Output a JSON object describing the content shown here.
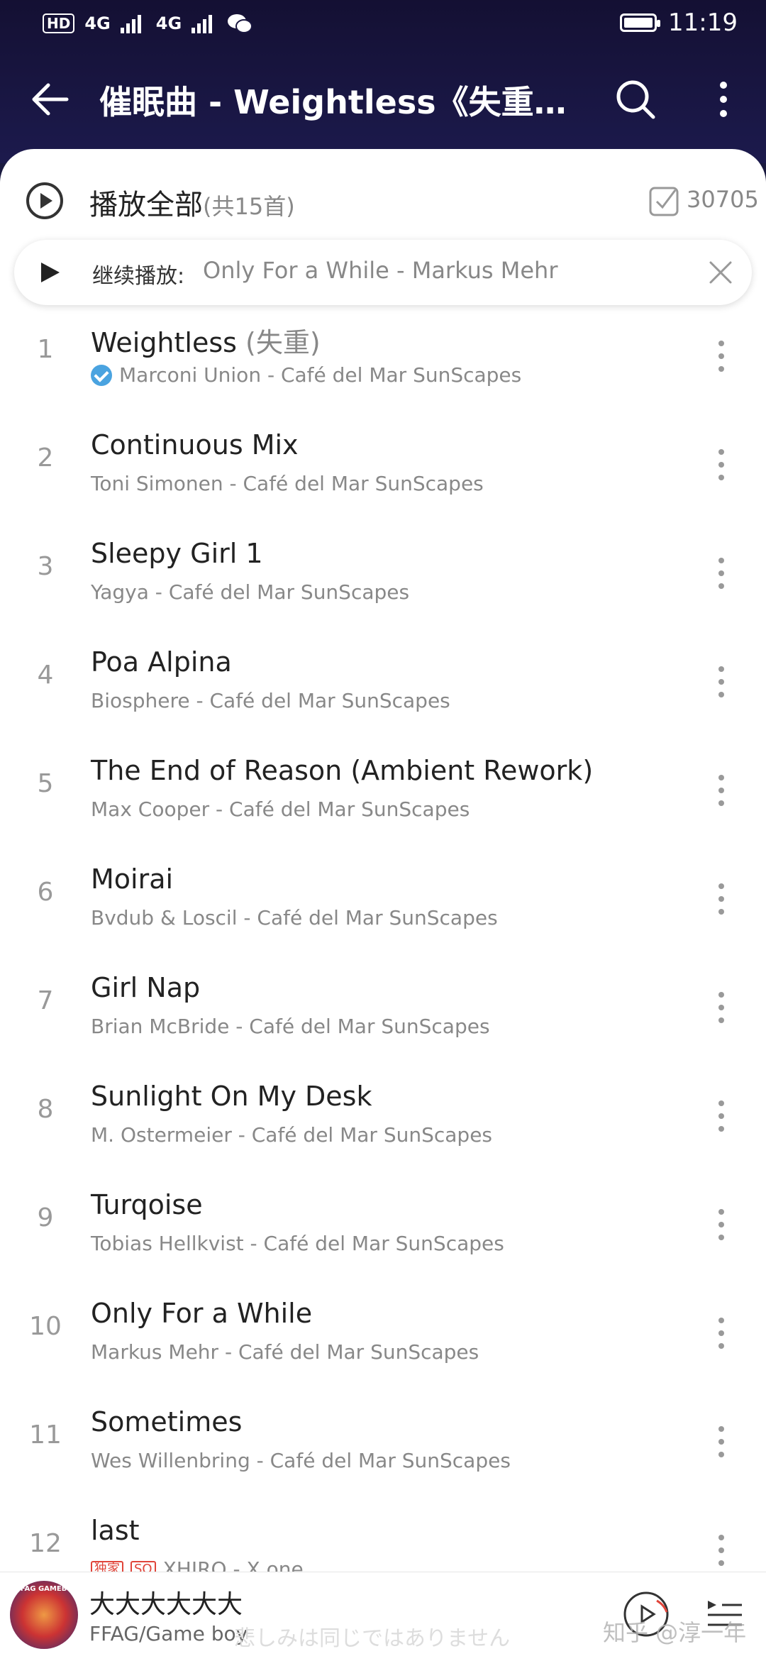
{
  "status_bar": {
    "hd": "HD",
    "net1": "4G",
    "net2": "4G",
    "time": "11:19"
  },
  "header": {
    "title": "催眠曲 - Weightless《失重》等..."
  },
  "play_all": {
    "label": "播放全部",
    "count": "(共15首)",
    "select_count": "30705"
  },
  "resume": {
    "label": "继续播放:",
    "track": "Only For a While - Markus Mehr"
  },
  "songs": [
    {
      "num": "1",
      "title": "Weightless",
      "alt": " (失重)",
      "subtitle": "Marconi Union - Café del Mar SunScapes"
    },
    {
      "num": "2",
      "title": "Continuous Mix",
      "alt": "",
      "subtitle": "Toni Simonen - Café del Mar SunScapes"
    },
    {
      "num": "3",
      "title": "Sleepy Girl 1",
      "alt": "",
      "subtitle": "Yagya - Café del Mar SunScapes"
    },
    {
      "num": "4",
      "title": "Poa Alpina",
      "alt": "",
      "subtitle": "Biosphere - Café del Mar SunScapes"
    },
    {
      "num": "5",
      "title": "The End of Reason (Ambient Rework)",
      "alt": "",
      "subtitle": "Max Cooper - Café del Mar SunScapes"
    },
    {
      "num": "6",
      "title": "Moirai",
      "alt": "",
      "subtitle": "Bvdub & Loscil - Café del Mar SunScapes"
    },
    {
      "num": "7",
      "title": "Girl Nap",
      "alt": "",
      "subtitle": "Brian McBride - Café del Mar SunScapes"
    },
    {
      "num": "8",
      "title": "Sunlight On My Desk",
      "alt": "",
      "subtitle": "M. Ostermeier - Café del Mar SunScapes"
    },
    {
      "num": "9",
      "title": "Turqoise",
      "alt": "",
      "subtitle": "Tobias Hellkvist - Café del Mar SunScapes"
    },
    {
      "num": "10",
      "title": "Only For a While",
      "alt": "",
      "subtitle": "Markus Mehr - Café del Mar SunScapes"
    },
    {
      "num": "11",
      "title": "Sometimes",
      "alt": "",
      "subtitle": "Wes Willenbring - Café del Mar SunScapes"
    },
    {
      "num": "12",
      "title": "last",
      "alt": "",
      "subtitle": "XHIRO - X one",
      "tag1": "独家",
      "tag2": "SQ"
    }
  ],
  "player": {
    "title": "大大大大大大",
    "artist": "FFAG/Game boy",
    "lyric": "悲しみは同じではありません",
    "watermark": "知乎 @淳一年",
    "cover_text": "FFAG GAMEBO"
  },
  "colors": {
    "header_bg": "#1c1a4d",
    "accent": "#e0453a",
    "verified": "#4aa3e0"
  }
}
